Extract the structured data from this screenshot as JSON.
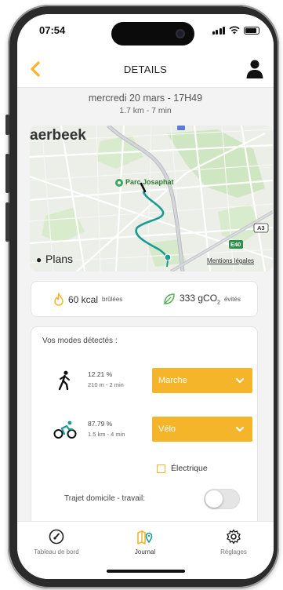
{
  "status_bar": {
    "time": "07:54"
  },
  "header": {
    "title": "DETAILS"
  },
  "trip": {
    "date": "mercredi 20 mars - 17H49",
    "distance_duration": "1.7 km - 7 min"
  },
  "map": {
    "district": "aerbeek",
    "park": "Parc Josaphat",
    "road_e40": "E40",
    "road_a3": "A3",
    "provider": "Plans",
    "legal": "Mentions légales"
  },
  "stats": {
    "calories": "60 kcal",
    "calories_unit": "brûlées",
    "co2": "333 gCO",
    "co2_sub": "2",
    "co2_unit": "évités"
  },
  "modes": {
    "title": "Vos modes détectés :",
    "items": [
      {
        "percent": "12.21 %",
        "detail": "210 m - 2 min",
        "selected": "Marche",
        "icon": "walk-icon"
      },
      {
        "percent": "87.79 %",
        "detail": "1.5 km - 4 min",
        "selected": "Vélo",
        "icon": "bike-icon"
      }
    ],
    "electric_label": "Électrique",
    "commute_label": "Trajet domicile - travail:"
  },
  "tabs": [
    {
      "label": "Tableau de bord",
      "icon": "gauge-icon"
    },
    {
      "label": "Journal",
      "icon": "map-pin-icon"
    },
    {
      "label": "Réglages",
      "icon": "gear-icon"
    }
  ],
  "colors": {
    "accent": "#f5b52b",
    "route": "#1a9c94",
    "leaf": "#4caf50",
    "flame": "#f5b52b"
  }
}
